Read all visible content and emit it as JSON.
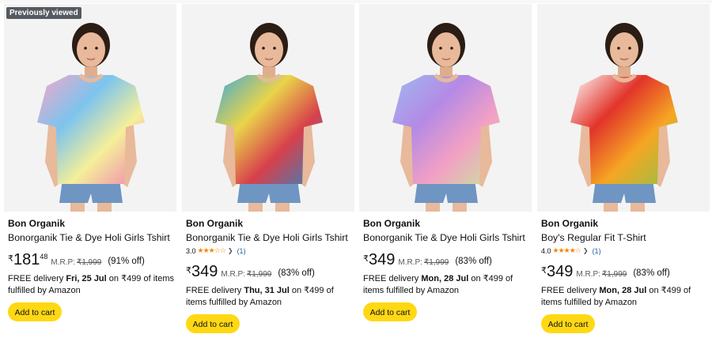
{
  "products": [
    {
      "badge": "Previously viewed",
      "brand": "Bon Organik",
      "title": "Bonorganik Tie & Dye Holi Girls Tshirt",
      "rating": null,
      "price_symbol": "₹",
      "price_whole": "181",
      "price_fraction": "48",
      "mrp_label": "M.R.P:",
      "mrp_value": "₹1,999",
      "discount": "(91% off)",
      "delivery_prefix": "FREE delivery",
      "delivery_date": "Fri, 25 Jul",
      "delivery_suffix": "on ₹499 of items fulfilled by Amazon",
      "cart_label": "Add to cart",
      "shirt_colors": [
        "#f7a6c8",
        "#7cc4ee",
        "#f4ef9a",
        "#f27fb0"
      ]
    },
    {
      "badge": "",
      "brand": "Bon Organik",
      "title": "Bonorganik Tie & Dye Holi Girls Tshirt",
      "rating": {
        "value": "3.0",
        "stars": 3,
        "count": "(1)"
      },
      "price_symbol": "₹",
      "price_whole": "349",
      "price_fraction": "",
      "mrp_label": "M.R.P:",
      "mrp_value": "₹1,999",
      "discount": "(83% off)",
      "delivery_prefix": "FREE delivery",
      "delivery_date": "Thu, 31 Jul",
      "delivery_suffix": "on ₹499 of items fulfilled by Amazon",
      "cart_label": "Add to cart",
      "shirt_colors": [
        "#3fa9d6",
        "#e9d44a",
        "#d8404b",
        "#2f86c4"
      ]
    },
    {
      "badge": "",
      "brand": "Bon Organik",
      "title": "Bonorganik Tie & Dye Holi Girls Tshirt",
      "rating": null,
      "price_symbol": "₹",
      "price_whole": "349",
      "price_fraction": "",
      "mrp_label": "M.R.P:",
      "mrp_value": "₹1,999",
      "discount": "(83% off)",
      "delivery_prefix": "FREE delivery",
      "delivery_date": "Mon, 28 Jul",
      "delivery_suffix": "on ₹499 of items fulfilled by Amazon",
      "cart_label": "Add to cart",
      "shirt_colors": [
        "#9fb9ee",
        "#b48ae6",
        "#f2a0c4",
        "#c8e69a"
      ]
    },
    {
      "badge": "",
      "brand": "Bon Organik",
      "title": "Boy's Regular Fit T-Shirt",
      "rating": {
        "value": "4.0",
        "stars": 4,
        "count": "(1)"
      },
      "price_symbol": "₹",
      "price_whole": "349",
      "price_fraction": "",
      "mrp_label": "M.R.P:",
      "mrp_value": "₹1,999",
      "discount": "(83% off)",
      "delivery_prefix": "FREE delivery",
      "delivery_date": "Mon, 28 Jul",
      "delivery_suffix": "on ₹499 of items fulfilled by Amazon",
      "cart_label": "Add to cart",
      "shirt_colors": [
        "#ffffff",
        "#e2342a",
        "#f5a623",
        "#8fc34a"
      ]
    }
  ]
}
